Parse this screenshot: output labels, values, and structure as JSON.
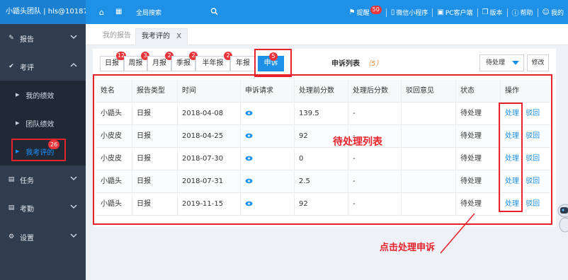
{
  "topbar": {
    "brand": "小鼯头团队 | hls@10187",
    "search_label": "全局搜索",
    "items": [
      {
        "label": "提醒",
        "badge": "50"
      },
      {
        "label": "微信小程序"
      },
      {
        "label": "PC客户端"
      },
      {
        "label": "版本"
      },
      {
        "label": "帮助"
      },
      {
        "label": "我的"
      }
    ]
  },
  "sidebar": {
    "report": "报告",
    "evaluate": "考评",
    "sub_items": [
      {
        "label": "我的绩效"
      },
      {
        "label": "团队绩效"
      },
      {
        "label": "我考评的",
        "badge": "26"
      }
    ],
    "task": "任务",
    "attendance": "考勤",
    "settings": "设置"
  },
  "tabs": {
    "inactive": "我的报告",
    "active": "我考评的",
    "close": "X"
  },
  "filters": [
    {
      "label": "日报",
      "badge": "12"
    },
    {
      "label": "周报",
      "badge": "3"
    },
    {
      "label": "月报",
      "badge": "2"
    },
    {
      "label": "季报",
      "badge": "2"
    },
    {
      "label": "半年报",
      "badge": "2"
    },
    {
      "label": "年报",
      "badge": ""
    },
    {
      "label": "申诉",
      "badge": "5"
    }
  ],
  "list": {
    "title": "申诉列表",
    "count": "（5）",
    "select_value": "待处理",
    "edit_label": "修改"
  },
  "table": {
    "headers": [
      "姓名",
      "报告类型",
      "时间",
      "申诉请求",
      "处理前分数",
      "处理后分数",
      "驳回意见",
      "状态",
      "操作"
    ],
    "rows": [
      {
        "name": "小鼯头",
        "type": "日报",
        "date": "2018-04-08",
        "before": "139.5",
        "after": "-",
        "reject": "",
        "status": "待处理",
        "act1": "处理",
        "act2": "驳回"
      },
      {
        "name": "小皮皮",
        "type": "日报",
        "date": "2018-04-25",
        "before": "92",
        "after": "-",
        "reject": "",
        "status": "待处理",
        "act1": "处理",
        "act2": "驳回"
      },
      {
        "name": "小皮皮",
        "type": "日报",
        "date": "2018-07-30",
        "before": "0",
        "after": "-",
        "reject": "",
        "status": "待处理",
        "act1": "处理",
        "act2": "驳回"
      },
      {
        "name": "小鼯头",
        "type": "日报",
        "date": "2018-07-31",
        "before": "2.5",
        "after": "-",
        "reject": "",
        "status": "待处理",
        "act1": "处理",
        "act2": "驳回"
      },
      {
        "name": "小鼯头",
        "type": "日报",
        "date": "2019-11-15",
        "before": "92",
        "after": "-",
        "reject": "",
        "status": "待处理",
        "act1": "处理",
        "act2": "驳回"
      }
    ]
  },
  "annotations": {
    "pending_list": "待处理列表",
    "click_hint": "点击处理申诉"
  },
  "colors": {
    "primary": "#1e90e6",
    "sidebar": "#2f3d4e",
    "highlight": "#e8222a"
  }
}
